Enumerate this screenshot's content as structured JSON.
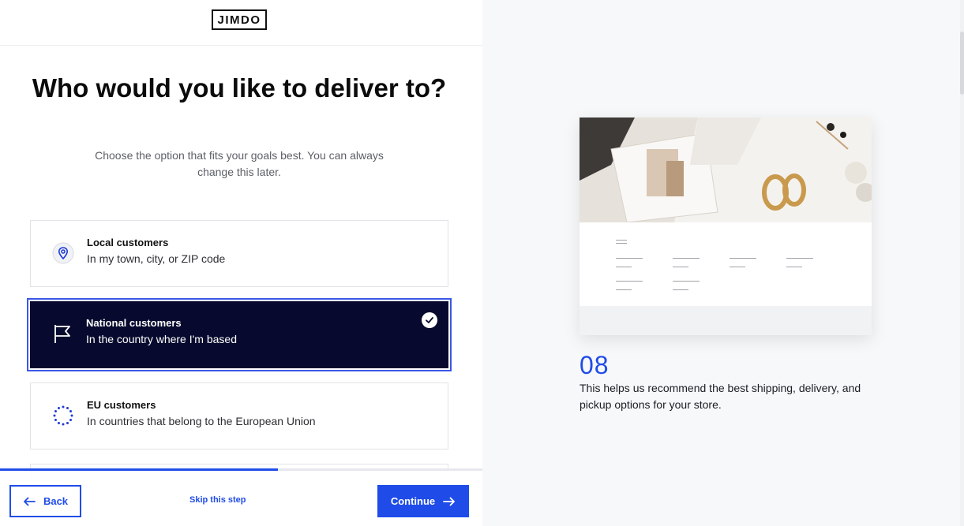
{
  "brand": {
    "logo_text": "JIMDO"
  },
  "main": {
    "title": "Who would you like to deliver to?",
    "subtitle": "Choose the option that fits your goals best. You can always change this later."
  },
  "options": [
    {
      "label": "Local customers",
      "description": "In my town, city, or ZIP code",
      "icon": "location-pin-icon",
      "selected": false
    },
    {
      "label": "National customers",
      "description": "In the country where I'm based",
      "icon": "flag-icon",
      "selected": true
    },
    {
      "label": "EU customers",
      "description": "In countries that belong to the European Union",
      "icon": "eu-stars-icon",
      "selected": false
    }
  ],
  "progress": {
    "fraction": 0.576
  },
  "footer": {
    "back_label": "Back",
    "skip_label": "Skip this step",
    "continue_label": "Continue"
  },
  "side": {
    "step_number": "08",
    "step_text": "This helps us recommend the best shipping, delivery, and pickup options for your store."
  },
  "colors": {
    "accent": "#1f4ce8",
    "selected_bg": "#070a2e",
    "right_panel_bg": "#f7f8fa"
  }
}
